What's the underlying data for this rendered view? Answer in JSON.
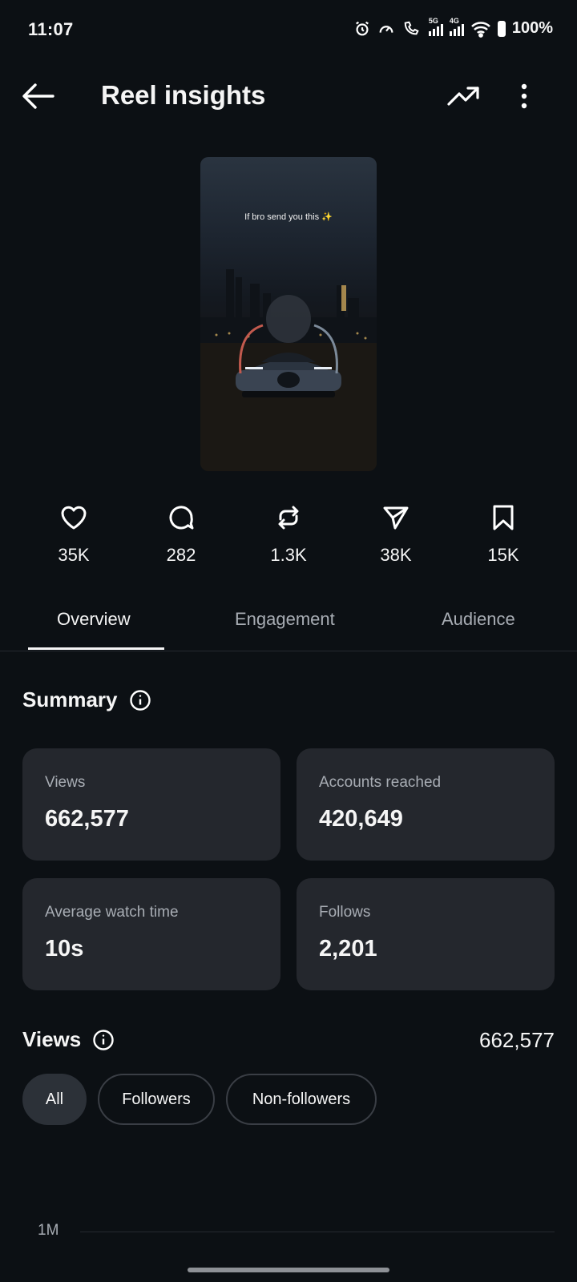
{
  "status_bar": {
    "time": "11:07",
    "sig1_label": "5G",
    "sig2_label": "4G",
    "battery": "100%"
  },
  "header": {
    "title": "Reel insights"
  },
  "reel": {
    "caption": "If bro send you this ✨"
  },
  "stats": [
    {
      "icon": "heart-icon",
      "value": "35K"
    },
    {
      "icon": "comment-icon",
      "value": "282"
    },
    {
      "icon": "repost-icon",
      "value": "1.3K"
    },
    {
      "icon": "share-icon",
      "value": "38K"
    },
    {
      "icon": "bookmark-icon",
      "value": "15K"
    }
  ],
  "tabs": [
    {
      "label": "Overview",
      "active": true
    },
    {
      "label": "Engagement",
      "active": false
    },
    {
      "label": "Audience",
      "active": false
    }
  ],
  "summary": {
    "title": "Summary",
    "cards": [
      {
        "label": "Views",
        "value": "662,577"
      },
      {
        "label": "Accounts reached",
        "value": "420,649"
      },
      {
        "label": "Average watch time",
        "value": "10s"
      },
      {
        "label": "Follows",
        "value": "2,201"
      }
    ]
  },
  "views": {
    "title": "Views",
    "total": "662,577",
    "filters": [
      {
        "label": "All",
        "active": true
      },
      {
        "label": "Followers",
        "active": false
      },
      {
        "label": "Non-followers",
        "active": false
      }
    ],
    "axis_top_label": "1M"
  },
  "colors": {
    "background": "#0c1014",
    "card": "#24272d",
    "muted_text": "#a8adb4"
  }
}
